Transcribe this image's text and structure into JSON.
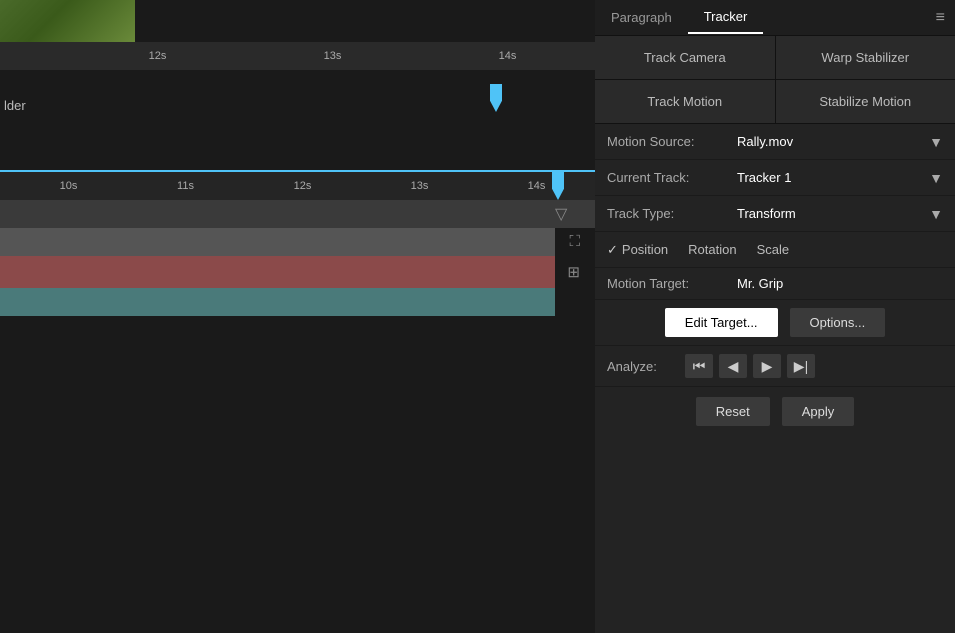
{
  "panels": {
    "paragraph_tab": "Paragraph",
    "tracker_tab": "Tracker",
    "menu_icon": "≡"
  },
  "tracker": {
    "track_camera_label": "Track Camera",
    "warp_stabilizer_label": "Warp Stabilizer",
    "track_motion_label": "Track Motion",
    "stabilize_motion_label": "Stabilize Motion",
    "motion_source_label": "Motion Source:",
    "motion_source_value": "Rally.mov",
    "current_track_label": "Current Track:",
    "current_track_value": "Tracker 1",
    "track_type_label": "Track Type:",
    "track_type_value": "Transform",
    "position_label": "Position",
    "rotation_label": "Rotation",
    "scale_label": "Scale",
    "motion_target_label": "Motion Target:",
    "motion_target_value": "Mr. Grip",
    "edit_target_label": "Edit Target...",
    "options_label": "Options...",
    "analyze_label": "Analyze:",
    "analyze_rewind": "⏮",
    "analyze_back": "◀",
    "analyze_forward": "▶",
    "analyze_fastforward": "▶|",
    "reset_label": "Reset",
    "apply_label": "Apply"
  },
  "timeline": {
    "top_ruler_marks": [
      "12s",
      "13s",
      "14s"
    ],
    "bottom_ruler_marks": [
      "10s",
      "11s",
      "12s",
      "13s",
      "14s"
    ],
    "label": "lder"
  }
}
